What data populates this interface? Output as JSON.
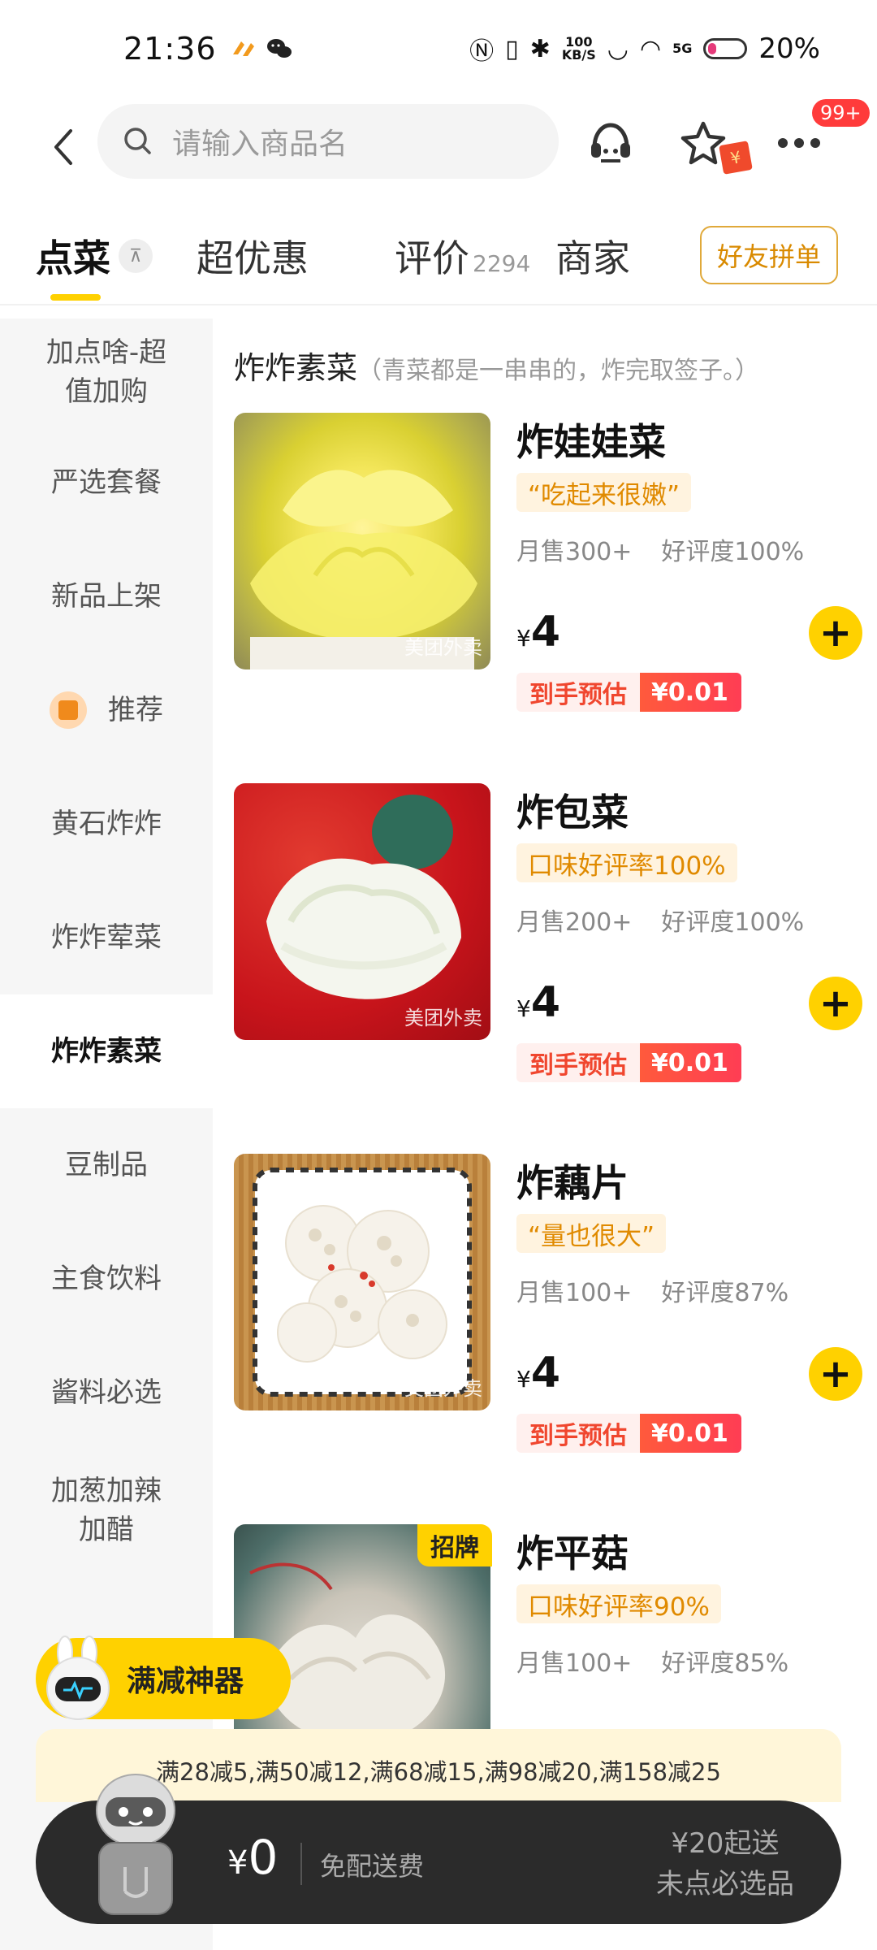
{
  "status": {
    "time": "21:36",
    "battery": "20%",
    "net_speed_top": "100",
    "net_speed_unit": "KB/S",
    "net_5g": "5G"
  },
  "search": {
    "placeholder": "请输入商品名",
    "notif_badge": "99+",
    "coupon_mark": "¥"
  },
  "tabs": {
    "order": "点菜",
    "deals": "超优惠",
    "reviews": "评价",
    "reviews_count": "2294",
    "merchant": "商家",
    "group_order": "好友拼单",
    "pin_glyph": "⊼"
  },
  "sidebar": {
    "items": [
      {
        "label": "加点啥-超值加购"
      },
      {
        "label": "严选套餐"
      },
      {
        "label": "新品上架"
      },
      {
        "label": "推荐"
      },
      {
        "label": "黄石炸炸"
      },
      {
        "label": "炸炸荤菜"
      },
      {
        "label": "炸炸素菜"
      },
      {
        "label": "豆制品"
      },
      {
        "label": "主食饮料"
      },
      {
        "label": "酱料必选"
      },
      {
        "label": "加葱加辣加醋"
      }
    ]
  },
  "category": {
    "title": "炸炸素菜",
    "note": "（青菜都是一串串的，炸完取签子。）"
  },
  "products": [
    {
      "name": "炸娃娃菜",
      "tag": "“吃起来很嫩”",
      "monthly_sales": "月售300+",
      "rating": "好评度100%",
      "currency": "¥",
      "price": "4",
      "estimate_label": "到手预估",
      "estimate_price": "¥0.01",
      "watermark": "美团外卖"
    },
    {
      "name": "炸包菜",
      "tag": "口味好评率100%",
      "monthly_sales": "月售200+",
      "rating": "好评度100%",
      "currency": "¥",
      "price": "4",
      "estimate_label": "到手预估",
      "estimate_price": "¥0.01",
      "watermark": "美团外卖"
    },
    {
      "name": "炸藕片",
      "tag": "“量也很大”",
      "monthly_sales": "月售100+",
      "rating": "好评度87%",
      "currency": "¥",
      "price": "4",
      "estimate_label": "到手预估",
      "estimate_price": "¥0.01",
      "watermark": "美团外卖"
    },
    {
      "name": "炸平菇",
      "signature": "招牌",
      "tag": "口味好评率90%",
      "monthly_sales": "月售100+",
      "rating": "好评度85%"
    }
  ],
  "promo": {
    "label": "满减神器",
    "discounts": "满28减5,满50减12,满68减15,满98减20,满158减25"
  },
  "cart": {
    "currency": "¥",
    "total": "0",
    "delivery": "免配送费",
    "min_order": "¥20起送",
    "required": "未点必选品"
  },
  "colors": {
    "accent": "#ffd100",
    "estimate_red": "#f0462e",
    "tag_orange": "#e08a00"
  }
}
